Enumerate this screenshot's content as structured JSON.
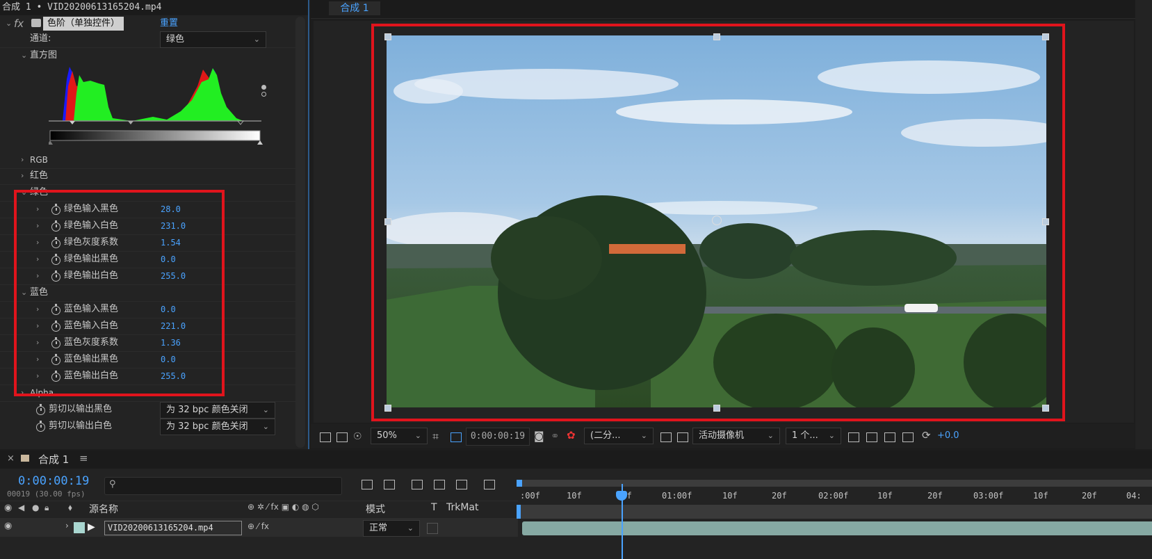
{
  "effect_panel": {
    "title": "合成 1 • VID20200613165204.mp4",
    "fx_label": "fx",
    "effect_name": "色阶（单独控件）",
    "reset_label": "重置",
    "channel_label": "通道:",
    "channel_value": "绿色",
    "histogram_label": "直方图",
    "groups": {
      "rgb": "RGB",
      "red": "红色",
      "green": "绿色",
      "blue": "蓝色",
      "alpha": "Alpha"
    },
    "green_params": [
      {
        "label": "绿色输入黑色",
        "value": "28.0"
      },
      {
        "label": "绿色输入白色",
        "value": "231.0"
      },
      {
        "label": "绿色灰度系数",
        "value": "1.54"
      },
      {
        "label": "绿色输出黑色",
        "value": "0.0"
      },
      {
        "label": "绿色输出白色",
        "value": "255.0"
      }
    ],
    "blue_params": [
      {
        "label": "蓝色输入黑色",
        "value": "0.0"
      },
      {
        "label": "蓝色输入白色",
        "value": "221.0"
      },
      {
        "label": "蓝色灰度系数",
        "value": "1.36"
      },
      {
        "label": "蓝色输出黑色",
        "value": "0.0"
      },
      {
        "label": "蓝色输出白色",
        "value": "255.0"
      }
    ],
    "clip_black_label": "剪切以输出黑色",
    "clip_black_value": "为 32 bpc 颜色关闭",
    "clip_white_label": "剪切以输出白色",
    "clip_white_value": "为 32 bpc 颜色关闭"
  },
  "viewer": {
    "tab": "合成 1",
    "zoom": "50%",
    "timecode": "0:00:00:19",
    "resolution": "(二分...",
    "camera": "活动摄像机",
    "views": "1 个...",
    "exposure": "+0.0"
  },
  "timeline": {
    "comp_tab": "合成 1",
    "current_time": "0:00:00:19",
    "frame_info": "00019 (30.00 fps)",
    "search_placeholder": "",
    "col_source_name": "源名称",
    "col_mode": "模式",
    "col_t": "T",
    "col_trkmat": "TrkMat",
    "layer_name": "VID20200613165204.mp4",
    "layer_mode": "正常",
    "ruler_ticks": [
      ":00f",
      "10f",
      "20f",
      "01:00f",
      "10f",
      "20f",
      "02:00f",
      "10f",
      "20f",
      "03:00f",
      "10f",
      "20f",
      "04:"
    ]
  },
  "colors": {
    "accent_blue": "#4aa3ff",
    "highlight_red": "#e0141c",
    "panel_bg": "#232323"
  }
}
